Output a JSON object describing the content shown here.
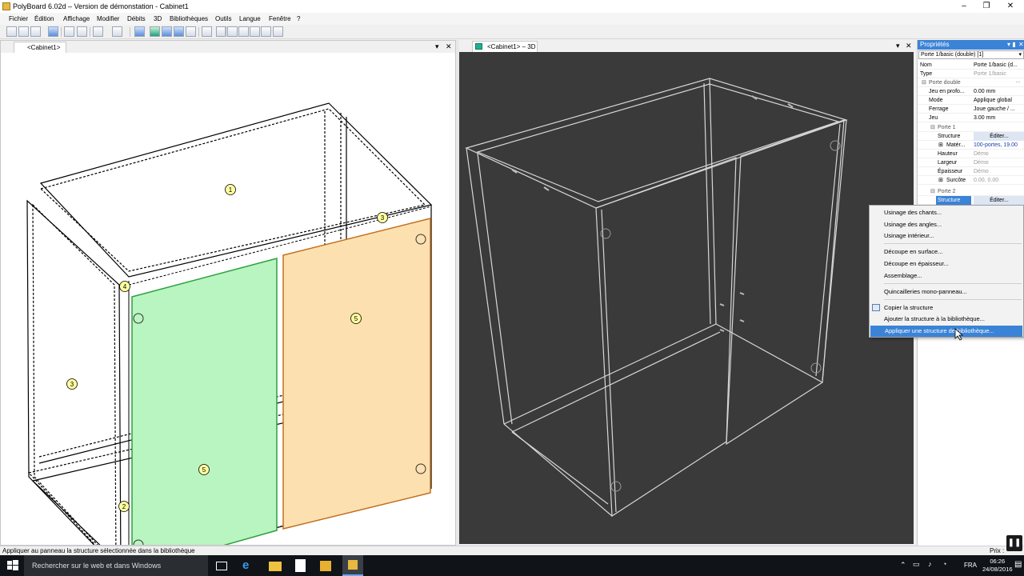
{
  "window": {
    "title": "PolyBoard 6.02d – Version de démonstation - Cabinet1",
    "controls": [
      "–",
      "❐",
      "✕"
    ]
  },
  "menu": [
    "Fichier",
    "Édition",
    "Affichage",
    "Modifier",
    "Débits",
    "3D",
    "Bibliothèques",
    "Outils",
    "Langue",
    "Fenêtre",
    "?"
  ],
  "left_pane": {
    "tab": "<Cabinet1>",
    "labels": {
      "n1": "1",
      "n3a": "3",
      "n3b": "3",
      "n4": "4",
      "n5a": "5",
      "n5b": "5",
      "n2": "2"
    }
  },
  "right_pane": {
    "tab": "<Cabinet1> – 3D"
  },
  "properties": {
    "title": "Propriétés",
    "combo": "Porte 1/basic (double) [1]",
    "rows": [
      {
        "k": "Nom",
        "v": "Porte 1/basic (d..."
      },
      {
        "k": "Type",
        "v": "Porte 1/basic"
      },
      {
        "k": "Porte double",
        "v": ""
      },
      {
        "k": "Jeu en profo...",
        "v": "0.00 mm"
      },
      {
        "k": "Mode",
        "v": "Applique global"
      },
      {
        "k": "Ferrage",
        "v": "Joue gauche / ..."
      },
      {
        "k": "Jeu",
        "v": "3.00 mm"
      },
      {
        "k": "Porte 1",
        "v": ""
      },
      {
        "k": "Structure",
        "v": "Éditer..."
      },
      {
        "k": "Matér...",
        "v": "100-portes, 19.00"
      },
      {
        "k": "Hauteur",
        "v": "Démo"
      },
      {
        "k": "Largeur",
        "v": "Démo"
      },
      {
        "k": "Épaisseur",
        "v": "Démo"
      },
      {
        "k": "Surcôte",
        "v": "0.00, 0.00"
      },
      {
        "k": "Porte 2",
        "v": ""
      },
      {
        "k": "Structure",
        "v": "Éditer..."
      }
    ]
  },
  "context_menu": {
    "items": [
      "Usinage des chants...",
      "Usinage des angles...",
      "Usinage intérieur...",
      "Découpe en surface...",
      "Découpe en épaisseur...",
      "Assemblage...",
      "Quincailleries mono-panneau...",
      "Copier la structure",
      "Ajouter la structure à la bibliothèque...",
      "Appliquer une structure de bibliothèque..."
    ]
  },
  "status": {
    "text": "Appliquer au panneau la structure sélectionnée dans la bibliothèque",
    "right": "Prix :"
  },
  "taskbar": {
    "search": "Rechercher sur le web et dans Windows",
    "lang": "FRA",
    "time": "06:26",
    "date": "24/08/2016"
  },
  "colors": {
    "accent": "#3b83d6",
    "door_green": "#b8f5c0",
    "door_orange": "#fde0b0",
    "viewport_bg": "#3a3a3a"
  }
}
